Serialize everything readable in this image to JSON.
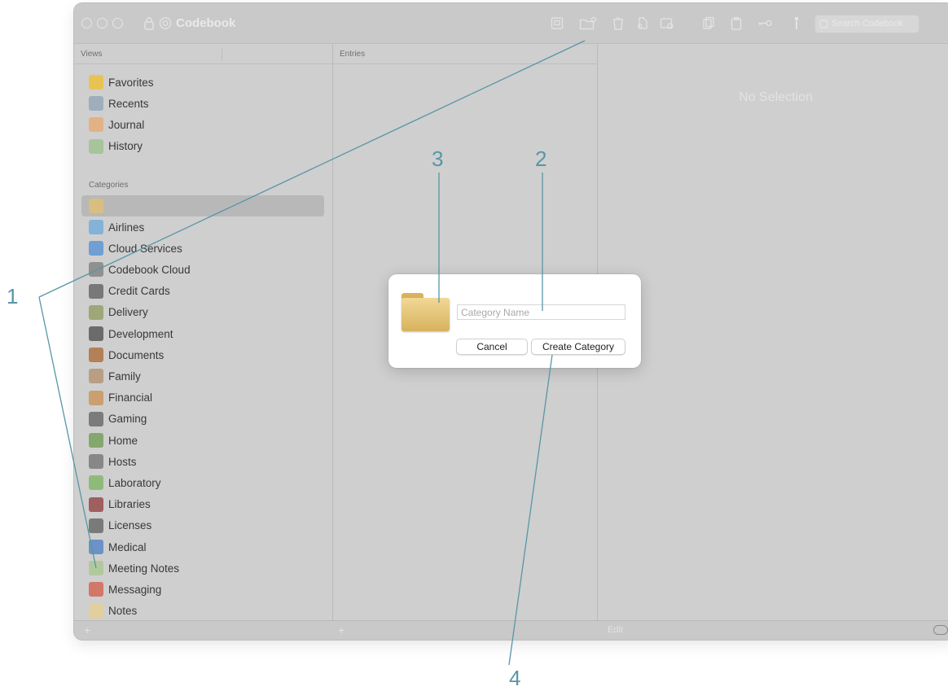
{
  "window": {
    "title": "Codebook",
    "search_placeholder": "Search Codebook"
  },
  "columns": {
    "views": "Views",
    "entries": "Entries"
  },
  "sidebar": {
    "views_items": [
      {
        "label": "Favorites",
        "icon": "star-icon"
      },
      {
        "label": "Recents",
        "icon": "stopwatch-icon"
      },
      {
        "label": "Journal",
        "icon": "journal-icon"
      },
      {
        "label": "History",
        "icon": "calendar-icon"
      }
    ],
    "categories_heading": "Categories",
    "selected_item": {
      "label": "",
      "icon": "folder-icon"
    },
    "categories": [
      {
        "label": "Airlines",
        "icon": "airplane-icon"
      },
      {
        "label": "Cloud Services",
        "icon": "cloud-tray-icon"
      },
      {
        "label": "Codebook Cloud",
        "icon": "safe-icon"
      },
      {
        "label": "Credit Cards",
        "icon": "credit-card-icon"
      },
      {
        "label": "Delivery",
        "icon": "delivery-truck-icon"
      },
      {
        "label": "Development",
        "icon": "bomb-icon"
      },
      {
        "label": "Documents",
        "icon": "briefcase-icon"
      },
      {
        "label": "Family",
        "icon": "house-family-icon"
      },
      {
        "label": "Financial",
        "icon": "money-bag-icon"
      },
      {
        "label": "Gaming",
        "icon": "gamepad-icon"
      },
      {
        "label": "Home",
        "icon": "home-icon"
      },
      {
        "label": "Hosts",
        "icon": "server-icon"
      },
      {
        "label": "Laboratory",
        "icon": "flask-icon"
      },
      {
        "label": "Libraries",
        "icon": "books-icon"
      },
      {
        "label": "Licenses",
        "icon": "laptop-icon"
      },
      {
        "label": "Medical",
        "icon": "medical-icon"
      },
      {
        "label": "Meeting Notes",
        "icon": "notes-calendar-icon"
      },
      {
        "label": "Messaging",
        "icon": "chat-bubbles-icon"
      },
      {
        "label": "Notes",
        "icon": "notepad-icon"
      }
    ]
  },
  "detail": {
    "empty_text": "No Selection"
  },
  "bottombar": {
    "add_symbol": "+",
    "edit_label": "Edit"
  },
  "dialog": {
    "name_placeholder": "Category Name",
    "cancel_label": "Cancel",
    "create_label": "Create Category"
  },
  "callouts": [
    "1",
    "2",
    "3",
    "4"
  ],
  "colors": {
    "callout": "#5896a6",
    "dimmed_window": "#cfcfcf",
    "folder": "#e4c06f"
  }
}
